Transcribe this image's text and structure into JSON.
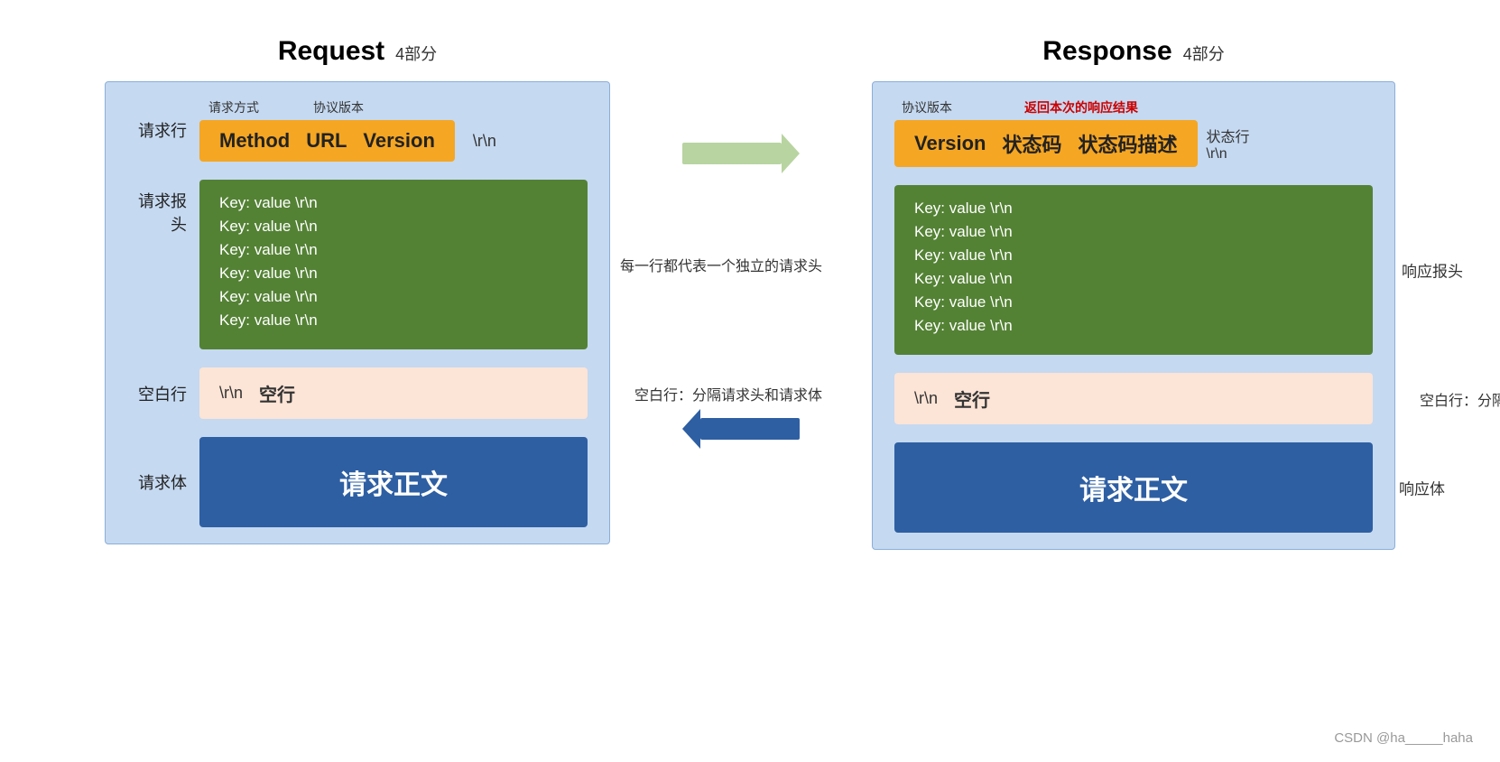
{
  "page": {
    "background": "#ffffff",
    "watermark": "CSDN @ha_____haha"
  },
  "request": {
    "title": "Request",
    "subtitle": "4部分",
    "rows": {
      "request_line": {
        "label": "请求行",
        "annotation_method": "请求方式",
        "annotation_version": "协议版本",
        "method": "Method",
        "url": "URL",
        "version": "Version",
        "rn": "\\r\\n"
      },
      "request_header": {
        "label": "请求报头",
        "annotation": "每一行都代表一个独立的请求头",
        "rows": [
          "Key:   value  \\r\\n",
          "Key:   value  \\r\\n",
          "Key:   value  \\r\\n",
          "Key:   value  \\r\\n",
          "Key:   value  \\r\\n",
          "Key:   value  \\r\\n"
        ]
      },
      "blank_line": {
        "label": "空白行",
        "rn": "\\r\\n",
        "blank": "空行",
        "annotation": "空白行：分隔请求头和请求体"
      },
      "request_body": {
        "label": "请求体",
        "text": "请求正文"
      }
    }
  },
  "response": {
    "title": "Response",
    "subtitle": "4部分",
    "rows": {
      "status_line": {
        "label": "状态行",
        "annotation_version": "协议版本",
        "annotation_result": "返回本次的响应结果",
        "version": "Version",
        "status_code": "状态码",
        "status_desc": "状态码描述",
        "rn": "\\r\\n"
      },
      "response_header": {
        "label": "响应报头",
        "rows": [
          "Key:   value  \\r\\n",
          "Key:   value  \\r\\n",
          "Key:   value  \\r\\n",
          "Key:   value  \\r\\n",
          "Key:   value  \\r\\n",
          "Key:   value  \\r\\n"
        ]
      },
      "blank_line": {
        "label": "空白行：分隔响应头和响应体",
        "rn": "\\r\\n",
        "blank": "空行"
      },
      "response_body": {
        "label": "响应体",
        "text": "请求正文"
      }
    }
  },
  "arrows": {
    "right_label": "→",
    "left_label": "←"
  }
}
